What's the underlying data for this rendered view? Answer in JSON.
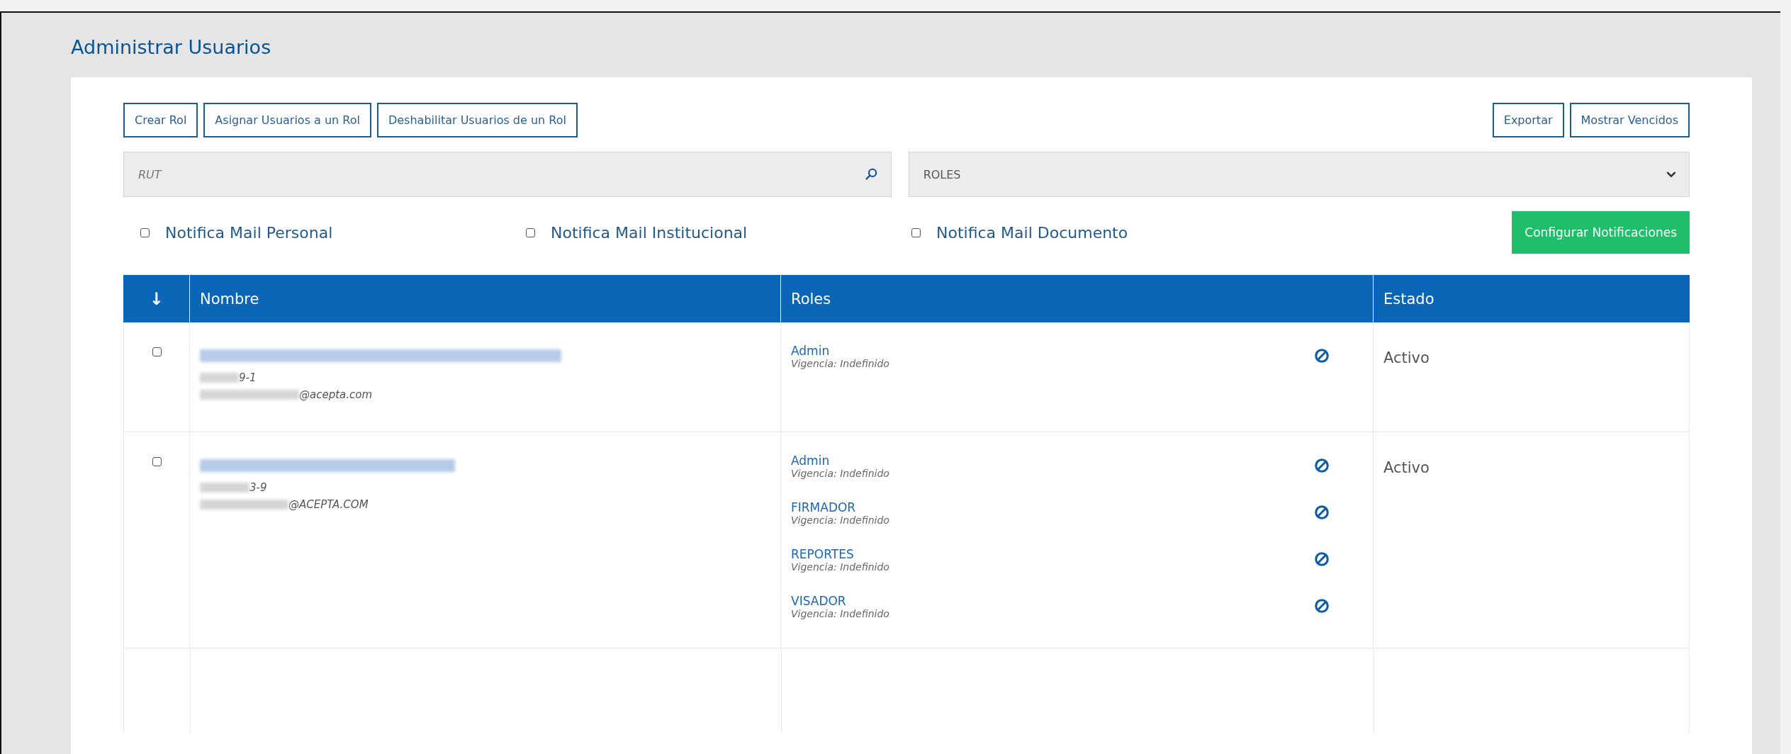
{
  "page_title": "Administrar Usuarios",
  "toolbar_left": [
    "Crear Rol",
    "Asignar Usuarios a un Rol",
    "Deshabilitar Usuarios de un Rol"
  ],
  "toolbar_right": [
    "Exportar",
    "Mostrar Vencidos"
  ],
  "search": {
    "placeholder": "RUT"
  },
  "roles_select": {
    "value": "ROLES"
  },
  "notifications": [
    {
      "label": "Notifica Mail Personal",
      "checked": false
    },
    {
      "label": "Notifica Mail Institucional",
      "checked": false
    },
    {
      "label": "Notifica Mail Documento",
      "checked": false
    }
  ],
  "configure_button": "Configurar Notificaciones",
  "table": {
    "sort_icon": "↓",
    "columns": [
      "Nombre",
      "Roles",
      "Estado"
    ],
    "rows": [
      {
        "checked": false,
        "rut": "9-1",
        "email": "@acepta.com",
        "roles": [
          {
            "name": "Admin",
            "validity": "Vigencia: Indefinido"
          }
        ],
        "status": "Activo"
      },
      {
        "checked": false,
        "rut": "3-9",
        "email": "@ACEPTA.COM",
        "roles": [
          {
            "name": "Admin",
            "validity": "Vigencia: Indefinido"
          },
          {
            "name": "FIRMADOR",
            "validity": "Vigencia: Indefinido"
          },
          {
            "name": "REPORTES",
            "validity": "Vigencia: Indefinido"
          },
          {
            "name": "VISADOR",
            "validity": "Vigencia: Indefinido"
          }
        ],
        "status": "Activo"
      }
    ]
  }
}
